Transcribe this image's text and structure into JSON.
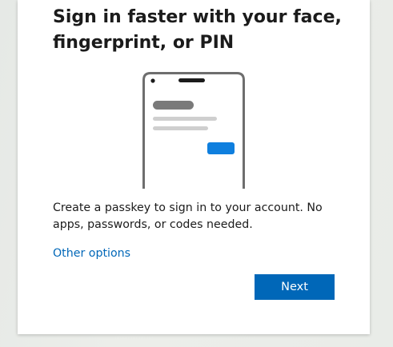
{
  "dialog": {
    "title": "Sign in faster with your face, fingerprint, or PIN",
    "description": "Create a passkey to sign in to your account. No apps, passwords, or codes needed.",
    "other_options_label": "Other options",
    "next_label": "Next"
  },
  "illustration": {
    "name": "phone-passkey-illustration",
    "frame_color": "#6e6e6e",
    "placeholder_dark": "#7a7a7a",
    "placeholder_light": "#cfcfcf",
    "accent": "#0f7fde"
  },
  "colors": {
    "accent": "#0067b8",
    "text": "#1b1b1b",
    "background": "#e9ece8"
  }
}
